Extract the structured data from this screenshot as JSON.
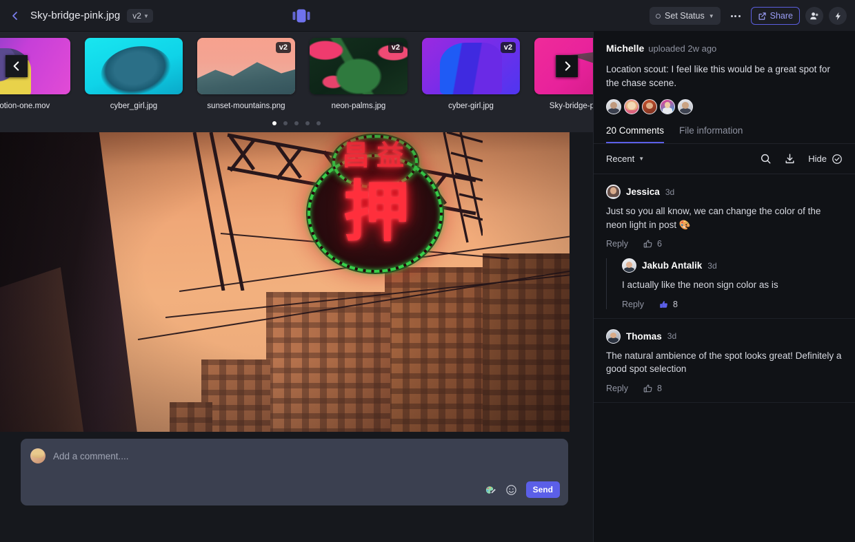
{
  "topbar": {
    "back_icon": "chevron-left-icon",
    "file_title": "Sky-bridge-pink.jpg",
    "version_label": "v2",
    "compare_icon": "compare-view-icon",
    "status_label": "Set Status",
    "more_icon": "more-options-icon",
    "share_label": "Share",
    "share_icon": "share-icon",
    "panel_toggle_icon": "collapse-panel-icon",
    "people_icon": "people-icon",
    "lightning_icon": "lightning-icon"
  },
  "filmstrip": {
    "prev_icon": "chevron-left-icon",
    "next_icon": "chevron-right-icon",
    "items": [
      {
        "label": "motion-one.mov",
        "version": "",
        "art": "art-motion"
      },
      {
        "label": "cyber_girl.jpg",
        "version": "",
        "art": "art-cyber1"
      },
      {
        "label": "sunset-mountains.png",
        "version": "v2",
        "art": "art-sunset"
      },
      {
        "label": "neon-palms.jpg",
        "version": "v2",
        "art": "art-palms"
      },
      {
        "label": "cyber-girl.jpg",
        "version": "v2",
        "art": "art-cyber2"
      },
      {
        "label": "Sky-bridge-pink.jpg",
        "version": "",
        "art": "art-skybridge"
      }
    ],
    "dot_count": 5,
    "active_dot": 0
  },
  "viewer": {
    "image_alt": "Sky-bridge-pink.jpg neon sign over city street at sunset",
    "neon_glyph_main": "押",
    "neon_glyph_small_1": "昌",
    "neon_glyph_small_2": "益"
  },
  "composer": {
    "placeholder": "Add a comment....",
    "avatar": "current-user-avatar",
    "annotate_icon": "annotate-brush-icon",
    "emoji_icon": "emoji-icon",
    "send_label": "Send"
  },
  "panel": {
    "author": "Michelle",
    "uploaded": "uploaded 2w ago",
    "description": "Location scout: I feel like this would be a great spot for the chase scene.",
    "collaborators": [
      "collaborator-1",
      "collaborator-2",
      "collaborator-3",
      "collaborator-4",
      "collaborator-5"
    ],
    "tabs": [
      {
        "label": "20 Comments",
        "active": true
      },
      {
        "label": "File information",
        "active": false
      }
    ],
    "toolbar": {
      "sort_label": "Recent",
      "search_icon": "search-icon",
      "download_icon": "download-icon",
      "hide_label": "Hide",
      "hide_icon": "check-circle-icon"
    },
    "comments": [
      {
        "author": "Jessica",
        "time": "3d",
        "text": "Just so you all know, we can change the color of the neon light in post 🎨",
        "reply_label": "Reply",
        "like_count": "6",
        "liked": false,
        "replies": [
          {
            "author": "Jakub Antalik",
            "time": "3d",
            "text": "I actually like the neon sign color as is",
            "reply_label": "Reply",
            "like_count": "8",
            "liked": true
          }
        ]
      },
      {
        "author": "Thomas",
        "time": "3d",
        "text": "The natural ambience of the spot looks great! Definitely a good spot selection",
        "reply_label": "Reply",
        "like_count": "8",
        "liked": false,
        "replies": []
      }
    ]
  },
  "colors": {
    "accent": "#5b5fe8",
    "panel_bg": "#101216",
    "app_bg": "#16181d",
    "strip_bg": "#22242b",
    "composer_bg": "#3b4050"
  }
}
